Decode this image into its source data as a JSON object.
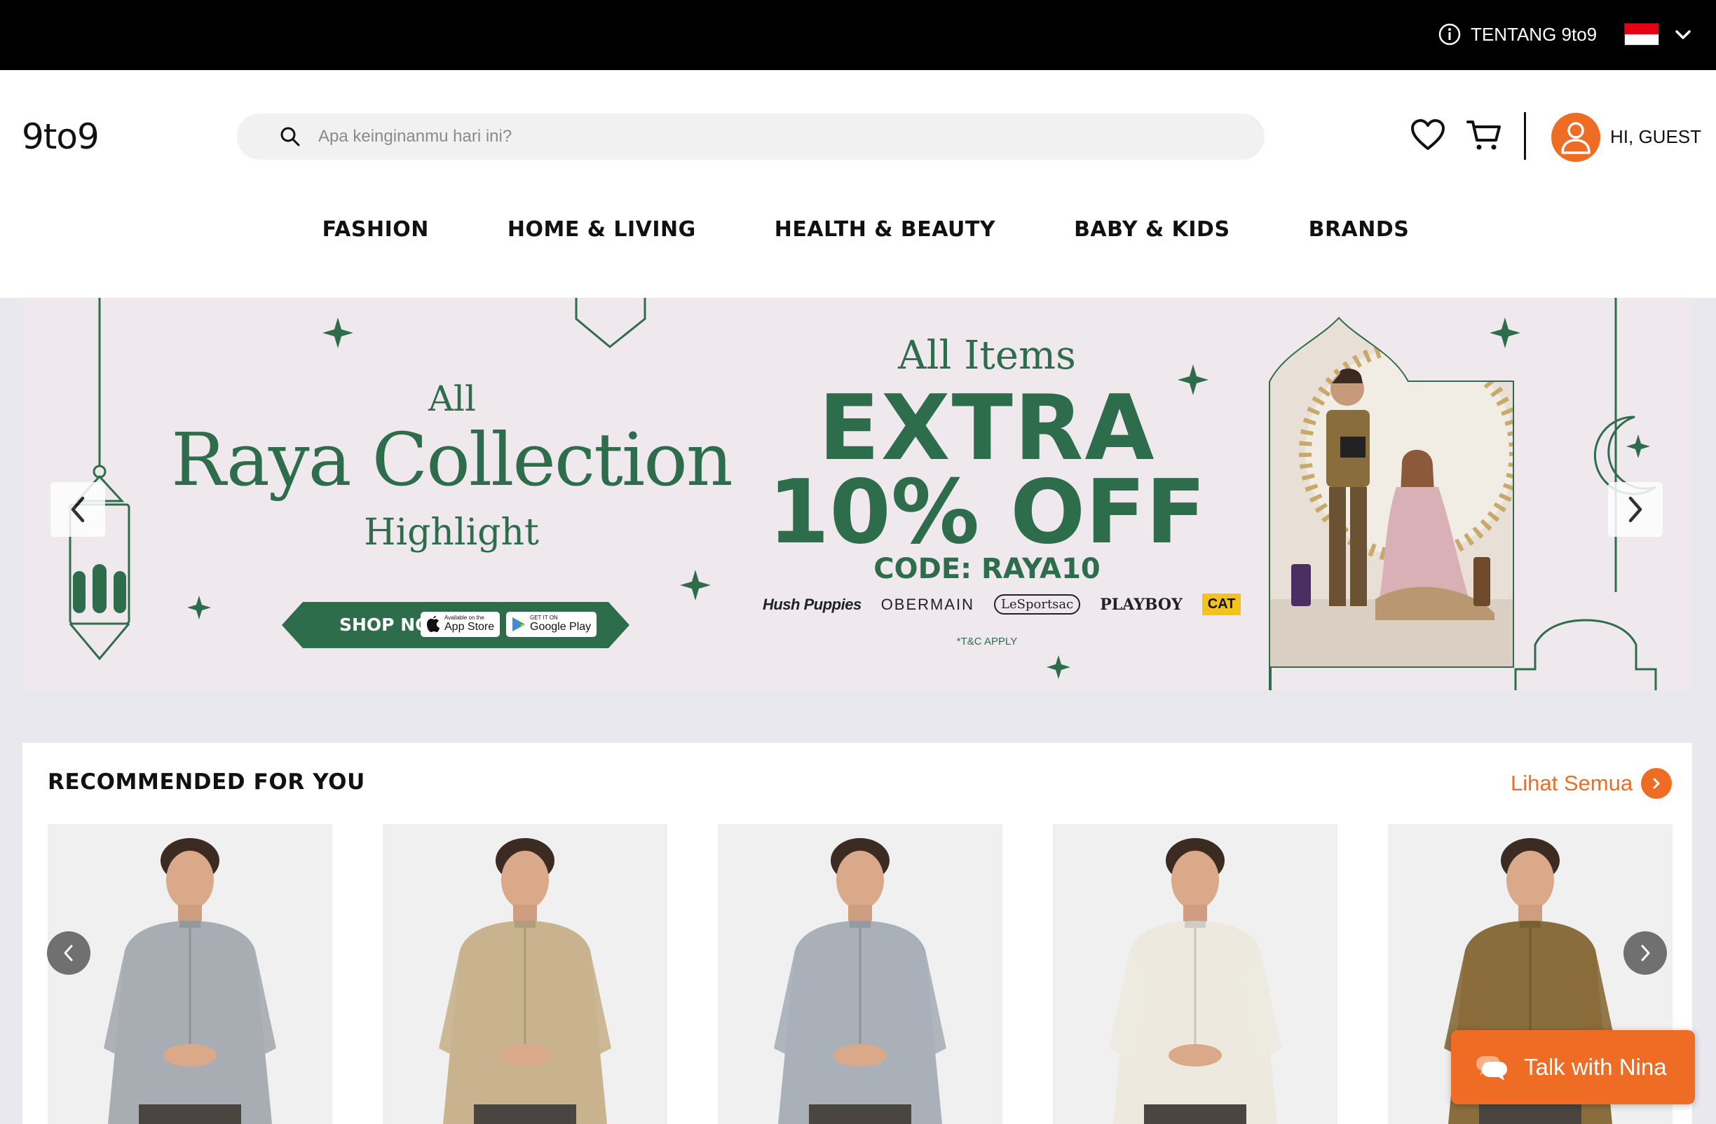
{
  "topbar": {
    "about_label": "TENTANG 9to9",
    "flag_colors": [
      "#e70011",
      "#ffffff"
    ]
  },
  "header": {
    "logo": "9to9",
    "search_placeholder": "Apa keinginanmu hari ini?",
    "greeting": "HI, GUEST"
  },
  "nav": {
    "items": [
      "FASHION",
      "HOME & LIVING",
      "HEALTH & BEAUTY",
      "BABY & KIDS",
      "BRANDS"
    ]
  },
  "banner": {
    "line_all": "All",
    "line_raya": "Raya Collection",
    "line_highlight": "Highlight",
    "line_items": "All Items",
    "line_extra": "EXTRA",
    "line_off": "10% OFF",
    "line_code": "CODE: RAYA10",
    "brands": [
      "Hush Puppies",
      "OBERMAIN",
      "LeSportsac",
      "PLAYBOY",
      "CAT"
    ],
    "tnc": "*T&C APPLY",
    "shop_now": "SHOP NOW",
    "app_store_small": "Available on the",
    "app_store": "App Store",
    "google_play_small": "GET IT ON",
    "google_play": "Google Play"
  },
  "recommended": {
    "title": "RECOMMENDED FOR YOU",
    "see_all": "Lihat Semua",
    "products": [
      {
        "shirt_color": "#a8adb3"
      },
      {
        "shirt_color": "#c9b38f"
      },
      {
        "shirt_color": "#a9b0b8"
      },
      {
        "shirt_color": "#ede9df"
      },
      {
        "shirt_color": "#8a6d3c"
      }
    ]
  },
  "chat": {
    "label": "Talk with Nina"
  },
  "colors": {
    "accent": "#ef6c24",
    "banner_green": "#2e6d4b",
    "banner_bg": "#efe9ee",
    "page_bg": "#e9e8ef"
  }
}
